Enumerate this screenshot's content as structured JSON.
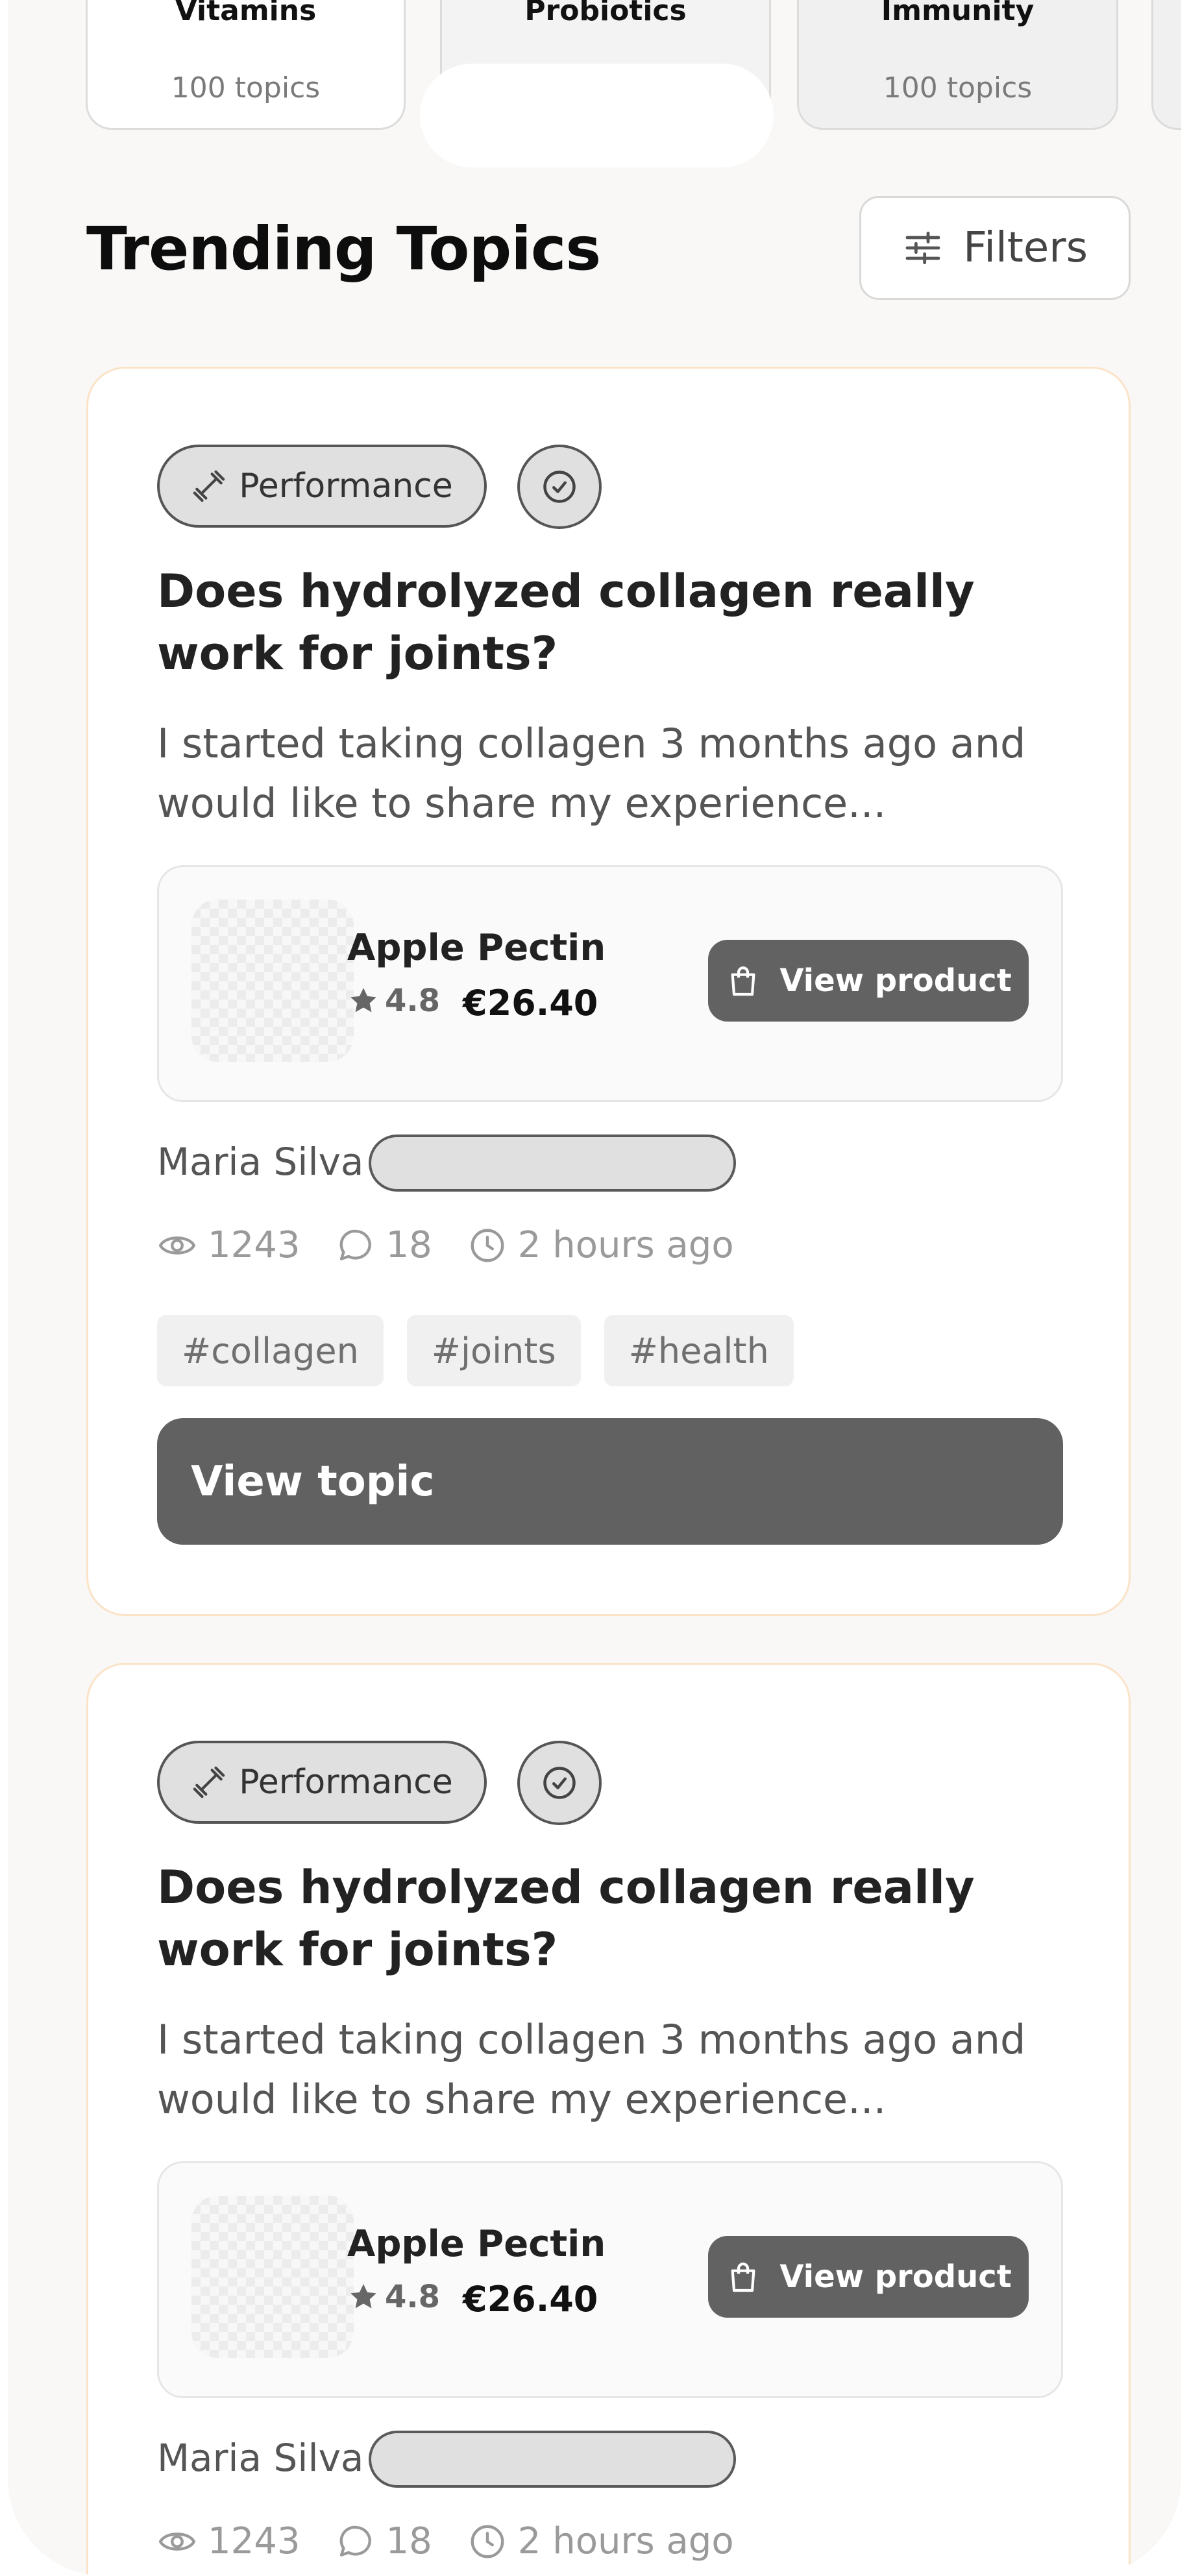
{
  "categories": [
    {
      "name": "Vitamins",
      "count": "100 topics"
    },
    {
      "name": "Probiotics",
      "count": ""
    },
    {
      "name": "Immunity",
      "count": "100 topics"
    }
  ],
  "section": {
    "title": "Trending Topics",
    "filters_label": "Filters"
  },
  "topics": [
    {
      "category": "Performance",
      "title": "Does hydrolyzed collagen really work for joints?",
      "excerpt": "I started taking collagen 3 months ago and would like to share my experience...",
      "product": {
        "name": "Apple Pectin",
        "rating": "4.8",
        "price": "€26.40",
        "button_label": "View product"
      },
      "author": "Maria Silva",
      "views": "1243",
      "comments": "18",
      "time": "2 hours ago",
      "tags": [
        "#collagen",
        "#joints",
        "#health"
      ],
      "button_label": "View topic"
    },
    {
      "category": "Performance",
      "title": "Does hydrolyzed collagen really work for joints?",
      "excerpt": "I started taking collagen 3 months ago and would like to share my experience...",
      "product": {
        "name": "Apple Pectin",
        "rating": "4.8",
        "price": "€26.40",
        "button_label": "View product"
      },
      "author": "Maria Silva",
      "views": "1243",
      "comments": "18",
      "time": "2 hours ago"
    }
  ],
  "icons": {
    "filters": "sliders-icon",
    "category": "dumbbell-icon",
    "verified": "check-circle-icon",
    "rating": "star-icon",
    "bag": "shopping-bag-icon",
    "views": "eye-icon",
    "comments": "comment-icon",
    "time": "clock-icon"
  },
  "colors": {
    "background": "#f9f8f6",
    "card_border": "#fbe3c8",
    "button_dark": "#616161",
    "badge_fill": "#e0e0e0"
  }
}
